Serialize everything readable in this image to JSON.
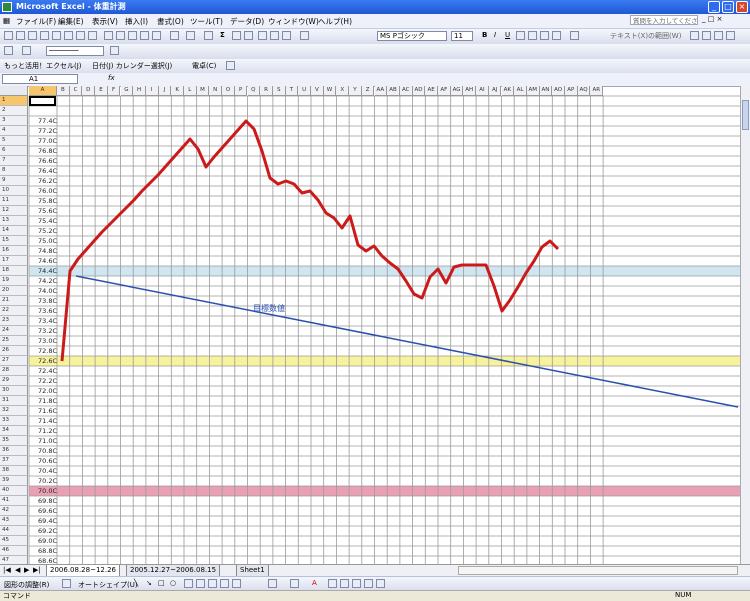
{
  "window": {
    "title": "Microsoft Excel - 体重計測",
    "buttons": [
      "_",
      "□",
      "×"
    ]
  },
  "menubar": {
    "items": [
      "ファイル(F)",
      "編集(E)",
      "表示(V)",
      "挿入(I)",
      "書式(O)",
      "ツール(T)",
      "データ(D)",
      "ウィンドウ(W)",
      "ヘルプ(H)"
    ],
    "help_placeholder": "質問を入力してください",
    "subwindow_buttons": "_ □ ×"
  },
  "toolbar_standard": {
    "font_name": "MS Pゴシック",
    "font_size": "11",
    "bold": "B",
    "italic": "I",
    "underline": "U"
  },
  "toolbar_extra": {
    "review_text": "テキスト(X)の範囲(W)",
    "caption_box": "もっと活用！エクセル(J)",
    "calendar": "日付(J) カレンダー選択(J)",
    "notes": "電卓(C)"
  },
  "formula_bar": {
    "name_box": "A1",
    "fx": "fx"
  },
  "columns": [
    "A",
    "B",
    "C",
    "D",
    "E",
    "F",
    "G",
    "H",
    "I",
    "J",
    "K",
    "L",
    "M",
    "N",
    "O",
    "P",
    "Q",
    "R",
    "S",
    "T",
    "U",
    "V",
    "W",
    "X",
    "Y",
    "Z",
    "AA",
    "AB",
    "AC",
    "AD",
    "AE",
    "AF",
    "AG",
    "AH",
    "AI",
    "AJ",
    "AK",
    "AL",
    "AM",
    "AN",
    "AO",
    "AP",
    "AQ",
    "AR"
  ],
  "rows": [
    {
      "n": "1",
      "v": ""
    },
    {
      "n": "2",
      "v": ""
    },
    {
      "n": "3",
      "v": "77.4C"
    },
    {
      "n": "4",
      "v": "77.2C"
    },
    {
      "n": "5",
      "v": "77.0C"
    },
    {
      "n": "6",
      "v": "76.8C"
    },
    {
      "n": "7",
      "v": "76.6C"
    },
    {
      "n": "8",
      "v": "76.4C"
    },
    {
      "n": "9",
      "v": "76.2C"
    },
    {
      "n": "10",
      "v": "76.0C"
    },
    {
      "n": "11",
      "v": "75.8C"
    },
    {
      "n": "12",
      "v": "75.6C"
    },
    {
      "n": "13",
      "v": "75.4C"
    },
    {
      "n": "14",
      "v": "75.2C"
    },
    {
      "n": "15",
      "v": "75.0C"
    },
    {
      "n": "16",
      "v": "74.8C"
    },
    {
      "n": "17",
      "v": "74.6C"
    },
    {
      "n": "18",
      "v": "74.4C"
    },
    {
      "n": "19",
      "v": "74.2C"
    },
    {
      "n": "20",
      "v": "74.0C"
    },
    {
      "n": "21",
      "v": "73.8C"
    },
    {
      "n": "22",
      "v": "73.6C"
    },
    {
      "n": "23",
      "v": "73.4C"
    },
    {
      "n": "24",
      "v": "73.2C"
    },
    {
      "n": "25",
      "v": "73.0C"
    },
    {
      "n": "26",
      "v": "72.8C"
    },
    {
      "n": "27",
      "v": "72.6C"
    },
    {
      "n": "28",
      "v": "72.4C"
    },
    {
      "n": "29",
      "v": "72.2C"
    },
    {
      "n": "30",
      "v": "72.0C"
    },
    {
      "n": "31",
      "v": "71.8C"
    },
    {
      "n": "32",
      "v": "71.6C"
    },
    {
      "n": "33",
      "v": "71.4C"
    },
    {
      "n": "34",
      "v": "71.2C"
    },
    {
      "n": "35",
      "v": "71.0C"
    },
    {
      "n": "36",
      "v": "70.8C"
    },
    {
      "n": "37",
      "v": "70.6C"
    },
    {
      "n": "38",
      "v": "70.4C"
    },
    {
      "n": "39",
      "v": "70.2C"
    },
    {
      "n": "40",
      "v": "70.0C"
    },
    {
      "n": "41",
      "v": "69.8C"
    },
    {
      "n": "42",
      "v": "69.6C"
    },
    {
      "n": "43",
      "v": "69.4C"
    },
    {
      "n": "44",
      "v": "69.2C"
    },
    {
      "n": "45",
      "v": "69.0C"
    },
    {
      "n": "46",
      "v": "68.8C"
    },
    {
      "n": "47",
      "v": "68.6C"
    }
  ],
  "highlight_rows": {
    "light_blue": "18",
    "yellow": "27",
    "pink": "40"
  },
  "band_colors": {
    "light_blue": "#cfe6f0",
    "yellow": "#f7f29c",
    "pink": "#e9a0b4"
  },
  "chart": {
    "weight_series": {
      "color": "#cc1a1a",
      "row_values": [
        27,
        18,
        16.8,
        15.9,
        15,
        14.1,
        13.3,
        12.5,
        11.7,
        10.9,
        10,
        9.2,
        8.4,
        7.5,
        6.6,
        5.7,
        4.8,
        5.8,
        7.6,
        6.6,
        5.7,
        4.8,
        3.9,
        3.0,
        3.8,
        6.0,
        8.7,
        9.3,
        9.0,
        9.3,
        10.2,
        10.0,
        10.9,
        12.2,
        12.7,
        13.7,
        12.5,
        15.4,
        16.0,
        15.5,
        16.5,
        17.2,
        17.8,
        19.0,
        20.3,
        20.7,
        18.6,
        17.8,
        19.2,
        17.6,
        17.4,
        17.4,
        17.4,
        17.4,
        19.5,
        22.0,
        20.9,
        19.6,
        18.2,
        17.0,
        15.6,
        15.0,
        15.8
      ]
    },
    "target_line": {
      "color": "#2a4fae",
      "label": "目標数値",
      "start_row": 18.5,
      "end_row": 31.6
    }
  },
  "sheet_tabs": [
    "2006.08.28~12.26",
    "2005.12.27~2006.08.15",
    "Sheet1"
  ],
  "drawbar": {
    "label": "図形の調整(R)",
    "autoshape": "オートシェイプ(U)"
  },
  "status": {
    "left": "コマンド",
    "right": "NUM"
  }
}
